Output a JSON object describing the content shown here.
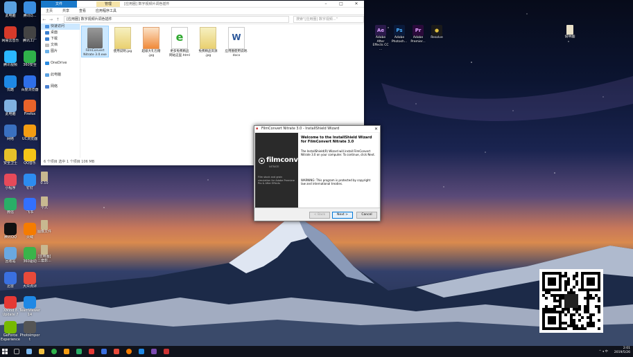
{
  "desktop": {
    "left_icons": [
      {
        "label": "此电脑",
        "color": "#5aa0e0"
      },
      {
        "label": "腾讯Q...",
        "color": "#3a8de0"
      },
      {
        "label": "网易云音乐",
        "color": "#d63a2a"
      },
      {
        "label": "腾讯工厂",
        "color": "#444"
      },
      {
        "label": "腾讯视频",
        "color": "#2ab7ff"
      },
      {
        "label": "360安全",
        "color": "#2fb24a"
      },
      {
        "label": "优酷",
        "color": "#1e88e5"
      },
      {
        "label": "百度浏览器",
        "color": "#2f6fe8"
      },
      {
        "label": "此电脑",
        "color": "#7fb0e0"
      },
      {
        "label": "Firefox",
        "color": "#e8632a"
      },
      {
        "label": "网络",
        "color": "#3a70c0"
      },
      {
        "label": "UC浏览器",
        "color": "#f39c12"
      },
      {
        "label": "安全卫士",
        "color": "#e6c12a"
      },
      {
        "label": "QQ音乐",
        "color": "#f5c518"
      },
      {
        "label": "小程序",
        "color": "#e64a5a"
      },
      {
        "label": "钉钉",
        "color": "#2d8cf0"
      },
      {
        "label": "微信",
        "color": "#2aae67"
      },
      {
        "label": "飞书",
        "color": "#3370ff"
      },
      {
        "label": "腾讯QQ",
        "color": "#111"
      },
      {
        "label": "火绒",
        "color": "#f57c00"
      },
      {
        "label": "回收站",
        "color": "#6aa8e0"
      },
      {
        "label": "360驱动",
        "color": "#3ab44a"
      },
      {
        "label": "迅雷",
        "color": "#3a70e0"
      },
      {
        "label": "大众点评",
        "color": "#e84a3a"
      },
      {
        "label": "XMind 8\nUpdate 7",
        "color": "#e53935"
      },
      {
        "label": "TeamViewer\n14",
        "color": "#1e88e5"
      },
      {
        "label": "GeForce\nExperience",
        "color": "#76b900"
      },
      {
        "label": "Photoimpor\nt",
        "color": "#555"
      }
    ],
    "mid_icons": [
      {
        "label": "0.10",
        "color": "#c8b890"
      },
      {
        "label": "个人",
        "color": "#c8b890"
      },
      {
        "label": "图像文件",
        "color": "#c8b890"
      },
      {
        "label": "[应用圈]\n二套影...",
        "color": "#c8b890"
      }
    ],
    "right_icons": [
      {
        "label": "Adobe After\nEffects CC ...",
        "color": "#2a1a4a",
        "text": "Ae",
        "fg": "#d9a0ff"
      },
      {
        "label": "Adobe\nPhotosh...",
        "color": "#0a1a3a",
        "text": "Ps",
        "fg": "#4ab0ff"
      },
      {
        "label": "Adobe\nPremier...",
        "color": "#2a0a3a",
        "text": "Pr",
        "fg": "#e0a0ff"
      },
      {
        "label": "Resolve",
        "color": "#1a1a1a",
        "text": "●",
        "fg": "#e0c040"
      }
    ],
    "far_right_icon": {
      "label": "说明图"
    }
  },
  "explorer": {
    "context_tab": "管理",
    "title": "[应用圈] 数字视频片调色插件",
    "tabs": [
      "文件",
      "主页",
      "共享",
      "查看",
      "应用程序工具"
    ],
    "address": "[应用圈] 数字视频片调色插件",
    "search_placeholder": "搜索\"[应用圈] 数字视频...\"",
    "nav": [
      {
        "label": "快速访问",
        "color": "#4a90e0",
        "selected": true
      },
      {
        "label": "桌面",
        "color": "#3a7fd0"
      },
      {
        "label": "下载",
        "color": "#3a7fd0"
      },
      {
        "label": "文档",
        "color": "#bbb"
      },
      {
        "label": "图片",
        "color": "#6ab0e8"
      },
      {
        "label": "OneDrive",
        "color": "#2a8ae0"
      },
      {
        "label": "此电脑",
        "color": "#5aa0e0"
      },
      {
        "label": "网络",
        "color": "#4a80d0"
      }
    ],
    "files": [
      {
        "name": "FilmConvert\nNitrate 3.0.exe",
        "type": "exe",
        "selected": true
      },
      {
        "name": "使用说明.jpg",
        "type": "jpg"
      },
      {
        "name": "超级大礼包赠\n.jpg",
        "type": "jpg2"
      },
      {
        "name": "更多免费精品\n网站这里.html",
        "type": "html"
      },
      {
        "name": "免费精品资源\n.jpg",
        "type": "jpg"
      },
      {
        "name": "应用圈使用说明.\ndocx",
        "type": "docx"
      }
    ],
    "status": "6 个项目    选中 1 个项目  106 MB"
  },
  "installer": {
    "title": "FilmConvert Nitrate 3.0 - InstallShield Wizard",
    "logo": "filmconvert",
    "logo_sub": "NITRATE",
    "left_desc": "Film stock and grain simulation for Adobe Premiere Pro & After Effects",
    "heading": "Welcome to the InstallShield Wizard for FilmConvert Nitrate 3.0",
    "body": "The InstallShield(R) Wizard will install FilmConvert Nitrate 3.0 on your computer. To continue, click Next.",
    "warning": "WARNING: This program is protected by copyright law and international treaties.",
    "back_label": "< Back",
    "next_label": "Next >",
    "cancel_label": "Cancel"
  },
  "taskbar": {
    "tray": "^ ◂ 中",
    "time": "2:01",
    "date": "2019/5/26"
  }
}
